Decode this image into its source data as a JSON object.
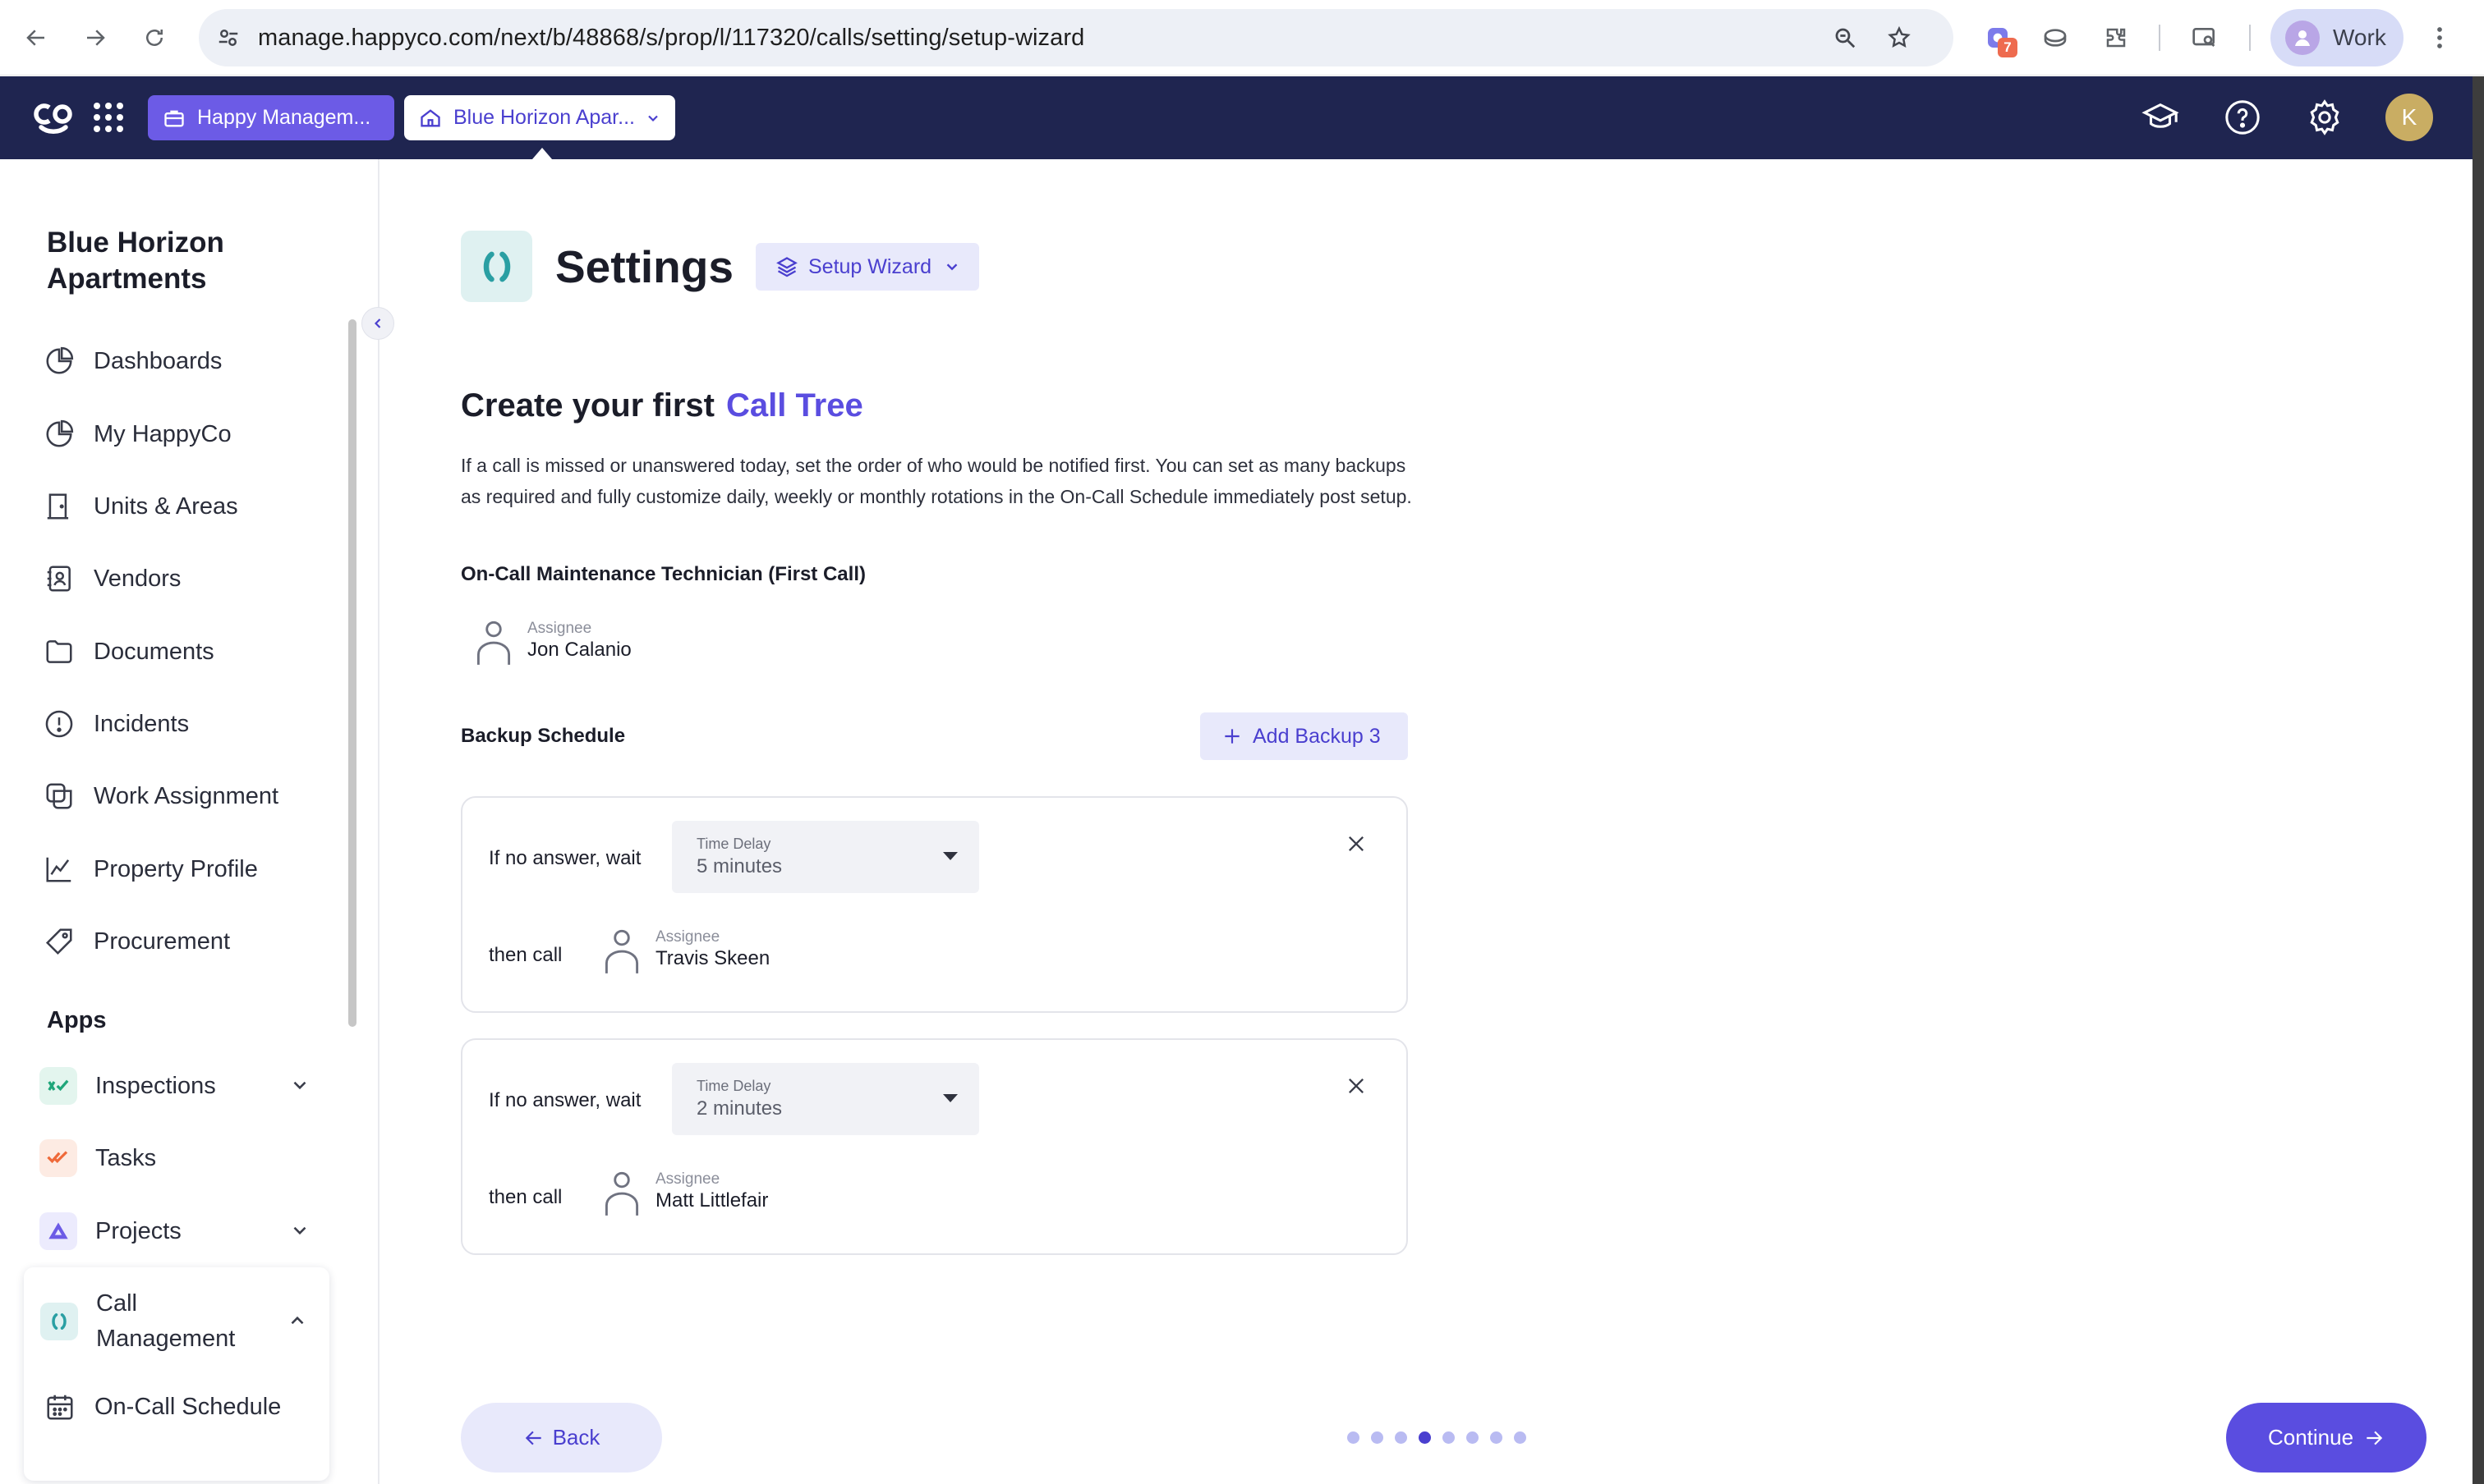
{
  "browser": {
    "url": "manage.happyco.com/next/b/48868/s/prop/l/117320/calls/setting/setup-wizard",
    "extension_badge": "7",
    "profile_label": "Work"
  },
  "appbar": {
    "company_scope": "Happy Managem...",
    "property_scope": "Blue Horizon Apar...",
    "user_initial": "K"
  },
  "sidebar": {
    "property_title": "Blue Horizon Apartments",
    "nav": [
      {
        "label": "Dashboards",
        "icon": "pie-chart-icon"
      },
      {
        "label": "My HappyCo",
        "icon": "pie-chart-icon"
      },
      {
        "label": "Units & Areas",
        "icon": "door-icon"
      },
      {
        "label": "Vendors",
        "icon": "contact-card-icon"
      },
      {
        "label": "Documents",
        "icon": "folder-icon"
      },
      {
        "label": "Incidents",
        "icon": "warning-icon"
      },
      {
        "label": "Work Assignment",
        "icon": "assignment-icon"
      },
      {
        "label": "Property Profile",
        "icon": "line-chart-icon"
      },
      {
        "label": "Procurement",
        "icon": "tag-icon"
      }
    ],
    "apps_label": "Apps",
    "apps": [
      {
        "label": "Inspections",
        "icon": "inspections-icon",
        "color": "#1fa67a"
      },
      {
        "label": "Tasks",
        "icon": "tasks-icon",
        "color": "#ef6a3a"
      },
      {
        "label": "Projects",
        "icon": "projects-icon",
        "color": "#6c5be6"
      }
    ],
    "call_management": {
      "label": "Call Management",
      "sub_item": "On-Call Schedule"
    }
  },
  "main": {
    "page_title": "Settings",
    "wizard_chip": "Setup Wizard",
    "heading": "Create your first",
    "heading_accent": "Call Tree",
    "description": "If a call is missed or unanswered today, set the order of who would be notified first. You can set as many backups as required and fully customize daily, weekly or monthly rotations in the On-Call Schedule immediately post setup.",
    "first_call_label": "On-Call Maintenance Technician (First Call)",
    "first_call_assignee": {
      "caption": "Assignee",
      "name": "Jon Calanio"
    },
    "backup_schedule_label": "Backup Schedule",
    "add_backup_label": "Add Backup 3",
    "backups": [
      {
        "wait_label": "If no answer, wait",
        "delay_caption": "Time Delay",
        "delay_value": "5 minutes",
        "then_label": "then call",
        "assignee_caption": "Assignee",
        "assignee_name": "Travis Skeen"
      },
      {
        "wait_label": "If no answer, wait",
        "delay_caption": "Time Delay",
        "delay_value": "2 minutes",
        "then_label": "then call",
        "assignee_caption": "Assignee",
        "assignee_name": "Matt Littlefair"
      }
    ]
  },
  "footer": {
    "back_label": "Back",
    "continue_label": "Continue",
    "steps_total": 8,
    "current_step": 4
  },
  "colors": {
    "appbar": "#1f2550",
    "accent": "#5a4de0",
    "accent_light": "#e8e9fb"
  }
}
